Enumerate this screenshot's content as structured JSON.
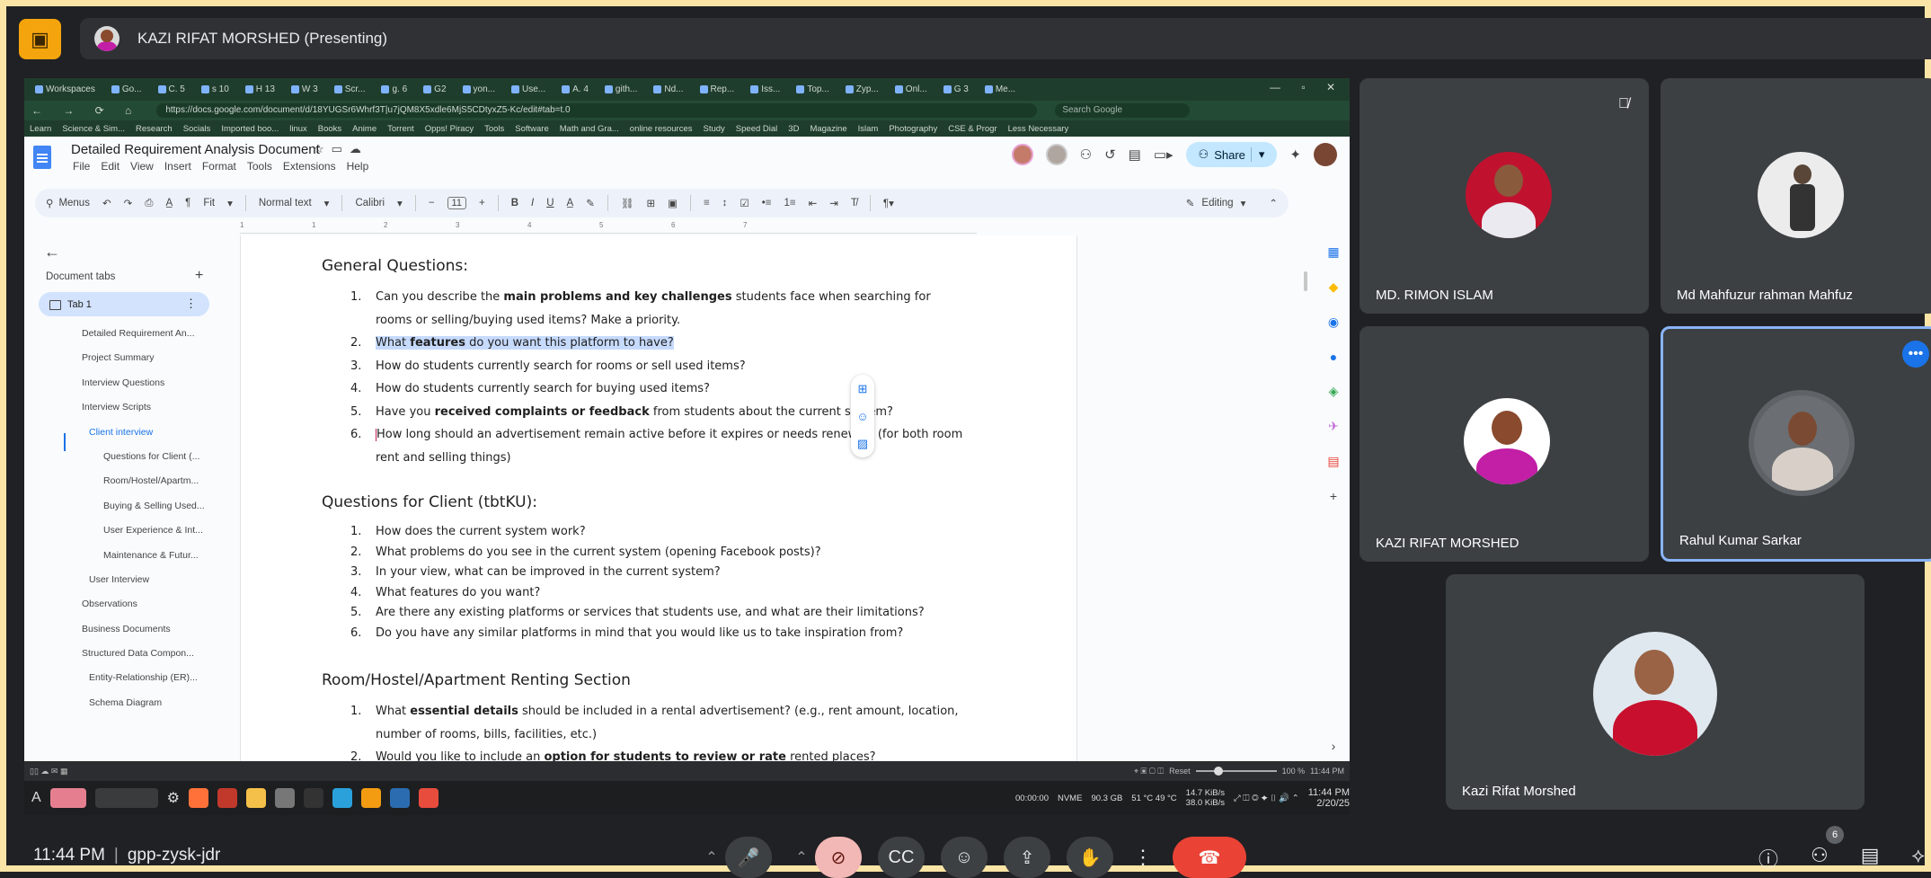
{
  "presenter_bar": {
    "label": "KAZI RIFAT MORSHED (Presenting)"
  },
  "browser": {
    "tabs": [
      "Workspaces",
      "Go...",
      "C. 5",
      "s 10",
      "H 13",
      "W 3",
      "Scr...",
      "g. 6",
      "G2",
      "yon...",
      "Use...",
      "A. 4",
      "gith...",
      "Nd...",
      "Rep...",
      "Iss...",
      "Top...",
      "Zyp...",
      "Onl...",
      "G 3",
      "Me..."
    ],
    "url": "https://docs.google.com/document/d/18YUGSr6Whrf3T|u7jQM8X5xdle6MjS5CDtyxZ5-Kc/edit#tab=t.0",
    "search_placeholder": "Search Google",
    "bookmarks": [
      "Learn",
      "Science & Sim...",
      "Research",
      "Socials",
      "Imported boo...",
      "linux",
      "Books",
      "Anime",
      "Torrent",
      "Opps! Piracy",
      "Tools",
      "Software",
      "Math and Gra...",
      "online resources",
      "Study",
      "Speed Dial",
      "3D",
      "Magazine",
      "Islam",
      "Photography",
      "CSE & Progr",
      "Less Necessary"
    ]
  },
  "docs": {
    "title": "Detailed Requirement Analysis Document",
    "menus": [
      "File",
      "Edit",
      "View",
      "Insert",
      "Format",
      "Tools",
      "Extensions",
      "Help"
    ],
    "share_label": "Share",
    "toolbar": {
      "search": "Menus",
      "zoom": "Fit",
      "style": "Normal text",
      "font": "Calibri",
      "size": "11",
      "mode": "Editing"
    },
    "ruler": [
      "1",
      "1",
      "2",
      "3",
      "4",
      "5",
      "6",
      "7"
    ],
    "sidebar": {
      "heading": "Document tabs",
      "tab": "Tab 1",
      "outline": [
        {
          "text": "Detailed Requirement An...",
          "level": 1
        },
        {
          "text": "Project Summary",
          "level": 1
        },
        {
          "text": "Interview Questions",
          "level": 1
        },
        {
          "text": "Interview Scripts",
          "level": 1
        },
        {
          "text": "Client interview",
          "level": 2,
          "active": true
        },
        {
          "text": "Questions for Client (...",
          "level": 3
        },
        {
          "text": "Room/Hostel/Apartm...",
          "level": 3
        },
        {
          "text": "Buying & Selling Used...",
          "level": 3
        },
        {
          "text": "User Experience & Int...",
          "level": 3
        },
        {
          "text": "Maintenance & Futur...",
          "level": 3
        },
        {
          "text": "User Interview",
          "level": 2
        },
        {
          "text": "Observations",
          "level": 1
        },
        {
          "text": "Business Documents",
          "level": 1
        },
        {
          "text": "Structured Data Compon...",
          "level": 1
        },
        {
          "text": "Entity-Relationship (ER)...",
          "level": 2
        },
        {
          "text": "Schema Diagram",
          "level": 2
        }
      ]
    },
    "content": {
      "h_general": "General Questions:",
      "general": [
        {
          "n": "1.",
          "a": "Can you describe the ",
          "b": "main problems and key challenges",
          "c": " students face when searching for rooms or selling/buying used items? Make a priority."
        },
        {
          "n": "2.",
          "a": "What ",
          "b": "features",
          "c": " do you want this platform to have?"
        },
        {
          "n": "3.",
          "a": "How do students currently search for rooms or sell used items?",
          "b": "",
          "c": ""
        },
        {
          "n": "4.",
          "a": "How do students currently search for buying used items?",
          "b": "",
          "c": ""
        },
        {
          "n": "5.",
          "a": "Have you ",
          "b": "received complaints or feedback",
          "c": " from students about the current system?"
        },
        {
          "n": "6.",
          "a": "How long should an advertisement remain active before it expires or needs renewal? (for both room rent and selling things)",
          "b": "",
          "c": ""
        }
      ],
      "h_client": "Questions for Client (tbtKU):",
      "client": [
        {
          "n": "1.",
          "t": "How does the current system work?"
        },
        {
          "n": "2.",
          "t": "What problems do you see in the current system (opening Facebook posts)?"
        },
        {
          "n": "3.",
          "t": "In your view, what can be improved in the current system?"
        },
        {
          "n": "4.",
          "t": "What features do you want?"
        },
        {
          "n": "5.",
          "t": "Are there any existing platforms or services that students use, and what are their limitations?"
        },
        {
          "n": "6.",
          "t": "Do you have any similar platforms in mind that you would like us to take inspiration from?"
        }
      ],
      "h_room": "Room/Hostel/Apartment Renting Section",
      "room": [
        {
          "n": "1.",
          "a": "What ",
          "b": "essential details",
          "c": " should be included in a rental advertisement? (e.g., rent amount, location, number of rooms, bills, facilities, etc.)"
        },
        {
          "n": "2.",
          "a": "Would you like to include an ",
          "b": "option for students to review or rate",
          "c": " rented places?"
        }
      ]
    }
  },
  "statusbar": {
    "reset": "Reset",
    "zoom": "100 %",
    "time": "11:44 PM"
  },
  "taskbar": {
    "timer": "00:00:00",
    "disk": "NVME",
    "disk_size": "90.3 GB",
    "temp": "51 °C  49 °C",
    "net_up": "14.7 KiB/s",
    "net_down": "38.0 KiB/s",
    "clock_time": "11:44 PM",
    "clock_date": "2/20/25"
  },
  "participants": [
    {
      "name": "MD. RIMON ISLAM",
      "muted": true
    },
    {
      "name": "Md Mahfuzur rahman Mahfuz"
    },
    {
      "name": "KAZI RIFAT MORSHED"
    },
    {
      "name": "Rahul Kumar Sarkar",
      "active": true
    },
    {
      "name": "Kazi Rifat Morshed"
    }
  ],
  "meeting": {
    "time": "11:44 PM",
    "code": "gpp-zysk-jdr",
    "participant_count": "6"
  },
  "colors": {
    "frame": "#fbe5a6",
    "presenter_icon": "#f4a40c",
    "end_call": "#ea4335",
    "active_tile": "#8ab4f8",
    "doc_highlight": "#c6dafc"
  }
}
